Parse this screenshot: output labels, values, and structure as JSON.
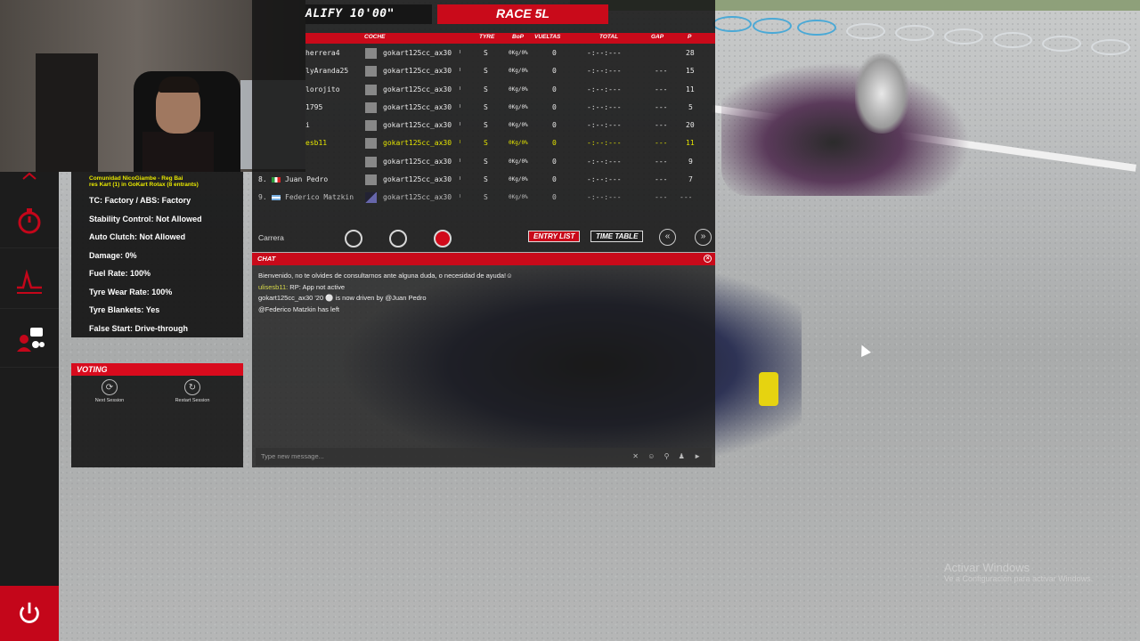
{
  "session": {
    "qualify_label": "ALIFY 10'00\"",
    "race_label": "RACE 5L"
  },
  "columns": {
    "coche": "COCHE",
    "tyre": "TYRE",
    "bop": "BoP",
    "vueltas": "VUELTAS",
    "total": "TOTAL",
    "gap": "GAP",
    "p": "P"
  },
  "standings": [
    {
      "pos": "",
      "driver": "herrera4",
      "car": "gokart125cc_ax30",
      "tyre": "S",
      "bop": "0Kg/0%",
      "laps": "0",
      "total": "-:--:---",
      "gap": "",
      "p": "28",
      "highlight": false
    },
    {
      "pos": "",
      "driver": "lyAranda25",
      "car": "gokart125cc_ax30",
      "tyre": "S",
      "bop": "0Kg/0%",
      "laps": "0",
      "total": "-:--:---",
      "gap": "---",
      "p": "15",
      "highlight": false
    },
    {
      "pos": "",
      "driver": "lorojito",
      "car": "gokart125cc_ax30",
      "tyre": "S",
      "bop": "0Kg/0%",
      "laps": "0",
      "total": "-:--:---",
      "gap": "---",
      "p": "11",
      "highlight": false
    },
    {
      "pos": "",
      "driver": "1795",
      "car": "gokart125cc_ax30",
      "tyre": "S",
      "bop": "0Kg/0%",
      "laps": "0",
      "total": "-:--:---",
      "gap": "---",
      "p": "5",
      "highlight": false
    },
    {
      "pos": "",
      "driver": "i",
      "car": "gokart125cc_ax30",
      "tyre": "S",
      "bop": "0Kg/0%",
      "laps": "0",
      "total": "-:--:---",
      "gap": "---",
      "p": "20",
      "highlight": false
    },
    {
      "pos": "",
      "driver": "esb11",
      "car": "gokart125cc_ax30",
      "tyre": "S",
      "bop": "0Kg/0%",
      "laps": "0",
      "total": "-:--:---",
      "gap": "---",
      "p": "11",
      "highlight": true
    },
    {
      "pos": "",
      "driver": "",
      "car": "gokart125cc_ax30",
      "tyre": "S",
      "bop": "0Kg/0%",
      "laps": "0",
      "total": "-:--:---",
      "gap": "---",
      "p": "9",
      "highlight": false
    },
    {
      "pos": "8.",
      "driver": "Juan Pedro",
      "car": "gokart125cc_ax30",
      "tyre": "S",
      "bop": "0Kg/0%",
      "laps": "0",
      "total": "-:--:---",
      "gap": "---",
      "p": "7",
      "highlight": false
    },
    {
      "pos": "9.",
      "driver": "Federico Matzkin",
      "car": "gokart125cc_ax30",
      "tyre": "S",
      "bop": "0Kg/0%",
      "laps": "0",
      "total": "-:--:---",
      "gap": "---",
      "p": "---",
      "highlight": false
    }
  ],
  "tabs": {
    "carrera": "Carrera",
    "entry_list": "ENTRY LIST",
    "time_table": "TIME TABLE",
    "prev": "«",
    "next": "»"
  },
  "server_info": {
    "header_line1": "Comunidad NicoGiambe - Reg Bai",
    "header_line2": "res Kart (1) in GoKart Rotax (8 entrants)",
    "rows": [
      "TC: Factory / ABS: Factory",
      "Stability Control: Not Allowed",
      "Auto Clutch: Not Allowed",
      "Damage: 0%",
      "Fuel Rate: 100%",
      "Tyre Wear Rate: 100%",
      "Tyre Blankets: Yes",
      "False Start: Drive-through"
    ]
  },
  "voting": {
    "title": "VOTING",
    "next_session": "Next Session",
    "restart_session": "Restart Session"
  },
  "chat": {
    "title": "CHAT",
    "messages": [
      {
        "name": "",
        "text": "Bienvenido, no te olvides de consultarnos ante alguna duda, o necesidad de ayuda!☺"
      },
      {
        "name": "ulisesb11:",
        "text": " RP: App not active"
      },
      {
        "name": "",
        "text": "gokart125cc_ax30 '20 ⚪ is now driven by @Juan Pedro"
      },
      {
        "name": "",
        "text": "@Federico Matzkin has left"
      }
    ],
    "placeholder": "Type new message..."
  },
  "watermark": {
    "line1": "Activar Windows",
    "line2": "Ve a Configuración para activar Windows."
  },
  "colors": {
    "accent_red": "#c90a1a",
    "highlight_yellow": "#e4e400"
  },
  "icons": [
    "stopwatch-icon",
    "telemetry-icon",
    "admin-chat-icon",
    "power-icon",
    "vote-next-icon",
    "vote-restart-icon"
  ]
}
